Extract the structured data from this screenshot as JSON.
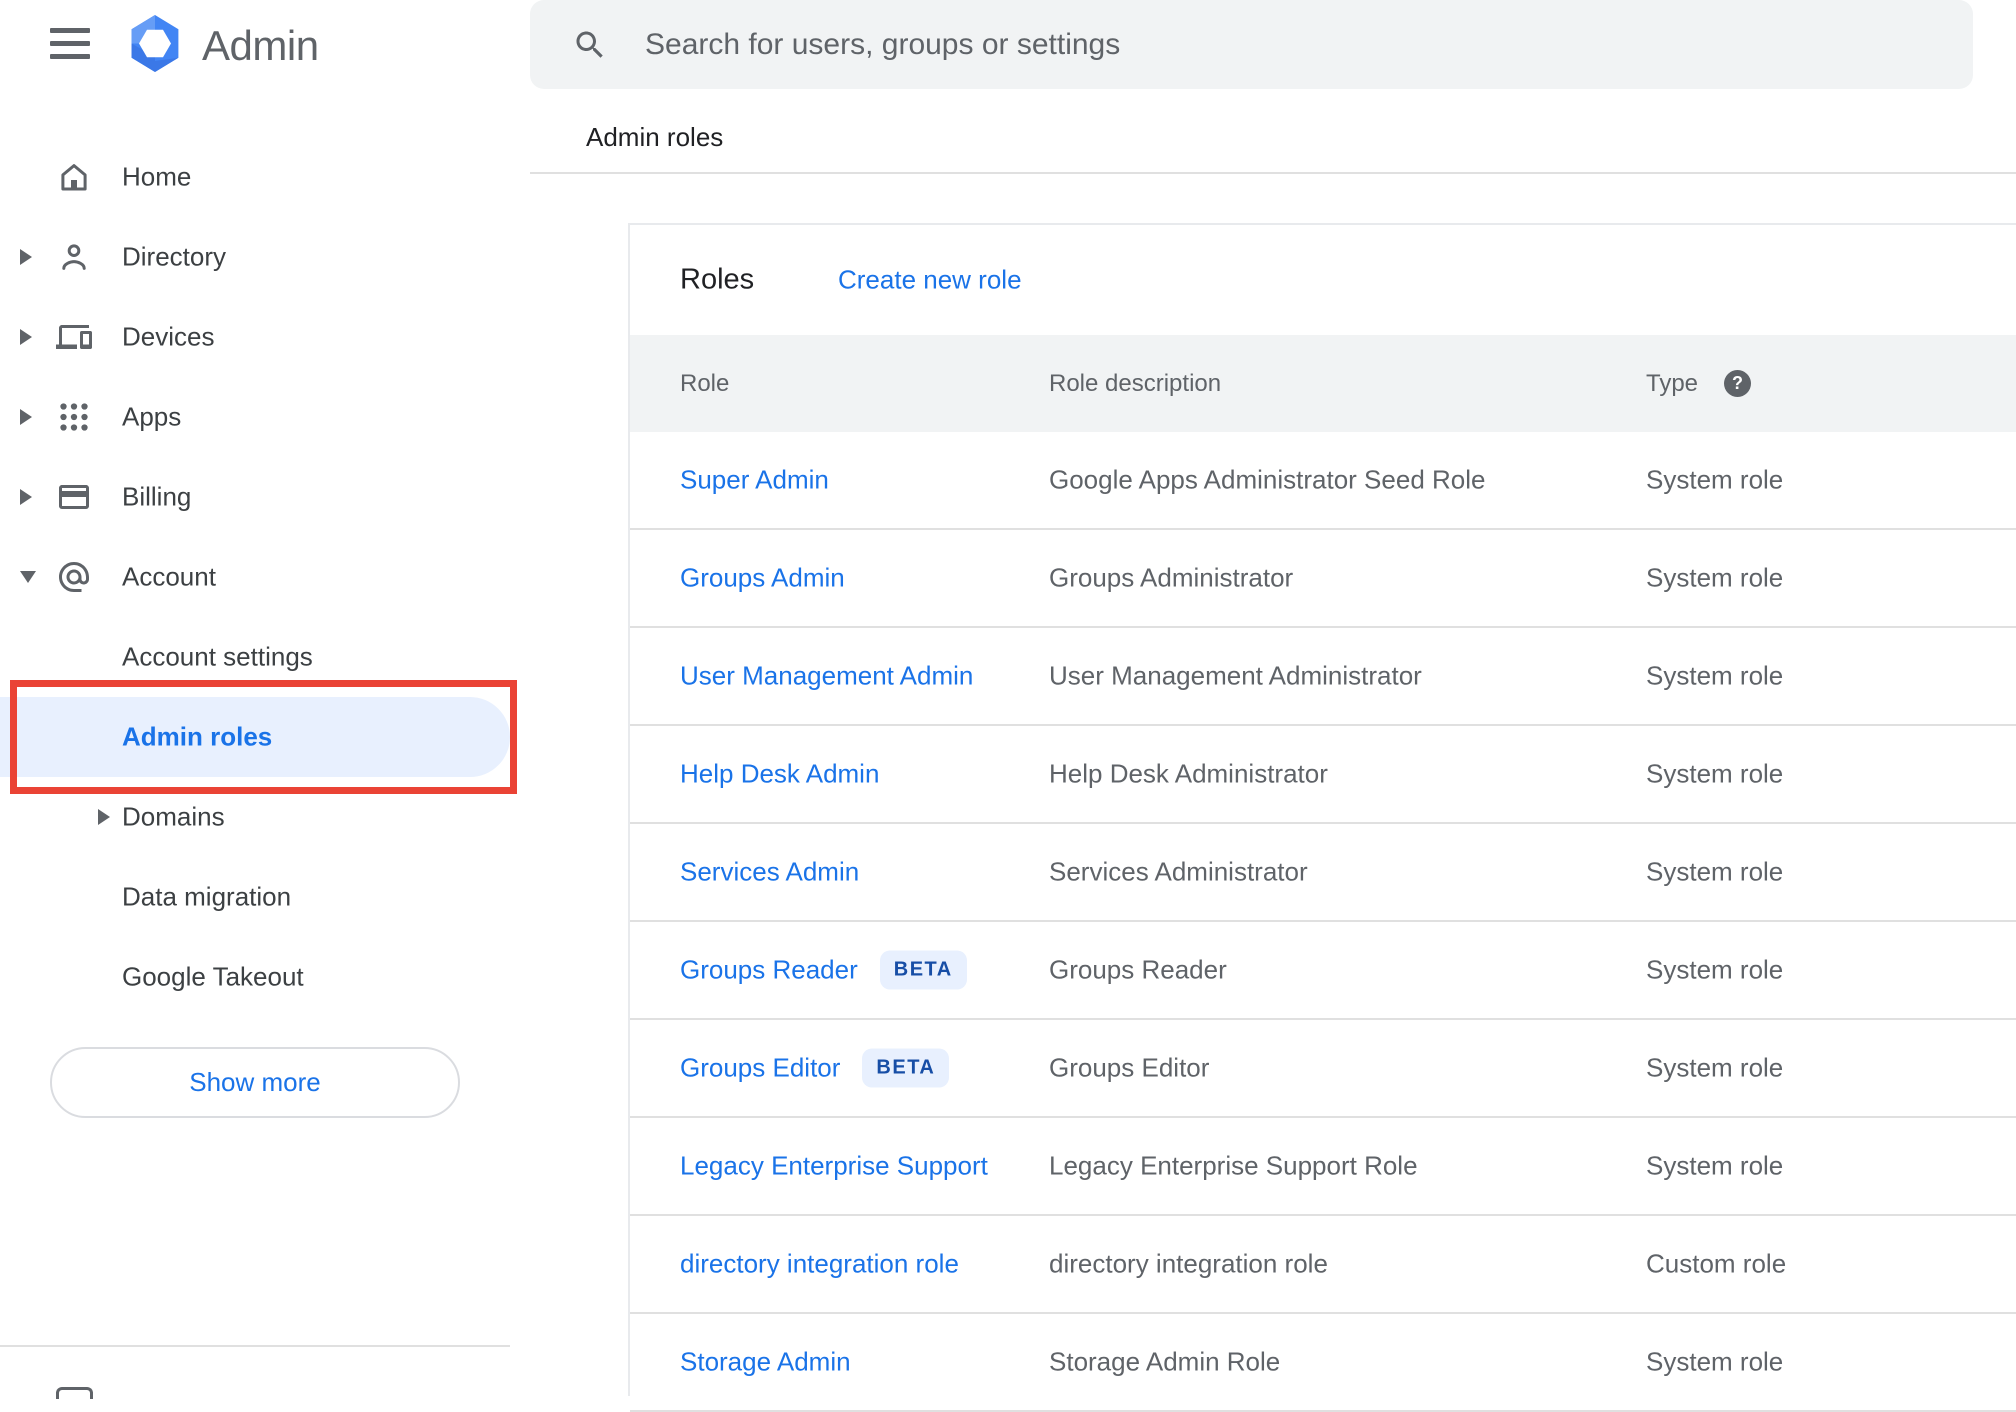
{
  "app": {
    "title": "Admin"
  },
  "topbar": {
    "search_placeholder": "Search for users, groups or settings"
  },
  "breadcrumb": {
    "label": "Admin roles"
  },
  "sidebar": {
    "items": [
      {
        "label": "Home"
      },
      {
        "label": "Directory"
      },
      {
        "label": "Devices"
      },
      {
        "label": "Apps"
      },
      {
        "label": "Billing"
      },
      {
        "label": "Account"
      }
    ],
    "sub_items": [
      {
        "label": "Account settings"
      },
      {
        "label": "Admin roles",
        "selected": true
      },
      {
        "label": "Domains"
      },
      {
        "label": "Data migration"
      },
      {
        "label": "Google Takeout"
      }
    ],
    "show_more_label": "Show more"
  },
  "main": {
    "section_title": "Roles",
    "create_link": "Create new role",
    "table": {
      "headers": [
        "Role",
        "Role description",
        "Type"
      ],
      "rows": [
        {
          "role": "Super Admin",
          "description": "Google Apps Administrator Seed Role",
          "type": "System role"
        },
        {
          "role": "Groups Admin",
          "description": "Groups Administrator",
          "type": "System role"
        },
        {
          "role": "User Management Admin",
          "description": "User Management Administrator",
          "type": "System role"
        },
        {
          "role": "Help Desk Admin",
          "description": "Help Desk Administrator",
          "type": "System role"
        },
        {
          "role": "Services Admin",
          "description": "Services Administrator",
          "type": "System role"
        },
        {
          "role": "Groups Reader",
          "badge": "BETA",
          "description": "Groups Reader",
          "type": "System role"
        },
        {
          "role": "Groups Editor",
          "badge": "BETA",
          "description": "Groups Editor",
          "type": "System role"
        },
        {
          "role": "Legacy Enterprise Support",
          "description": "Legacy Enterprise Support Role",
          "type": "System role"
        },
        {
          "role": "directory integration role",
          "description": "directory integration role",
          "type": "Custom role"
        },
        {
          "role": "Storage Admin",
          "description": "Storage Admin Role",
          "type": "System role"
        }
      ]
    }
  },
  "icons": {
    "help_glyph": "?"
  },
  "colors": {
    "accent_blue": "#1a73e8",
    "selected_pill_bg": "#e8f0fe",
    "annotation_red": "#ea4335",
    "table_header_bg": "#f1f3f4",
    "divider": "#e0e0e0",
    "logo_blue": "#4285f4"
  }
}
